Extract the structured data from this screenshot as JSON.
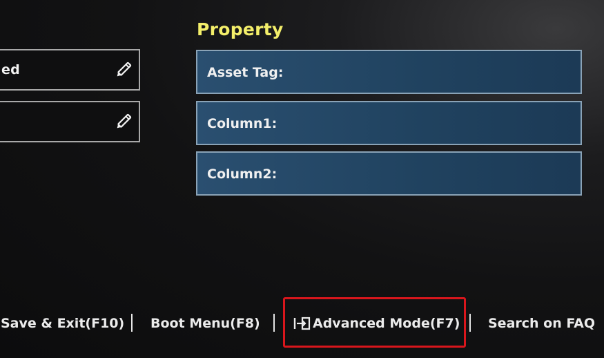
{
  "left_panel": {
    "fields": [
      {
        "value": "ed"
      },
      {
        "value": ""
      }
    ]
  },
  "property": {
    "title": "Property",
    "fields": [
      {
        "label": "Asset Tag:"
      },
      {
        "label": "Column1:"
      },
      {
        "label": "Column2:"
      }
    ]
  },
  "footer": {
    "save_exit": "Save & Exit(F10)",
    "boot_menu": "Boot Menu(F8)",
    "advanced_mode": "Advanced Mode(F7)",
    "search_faq": "Search on FAQ"
  },
  "colors": {
    "title_yellow": "#f4ef6a",
    "field_blue": "#2a4f70",
    "highlight_red": "#d9161c"
  }
}
